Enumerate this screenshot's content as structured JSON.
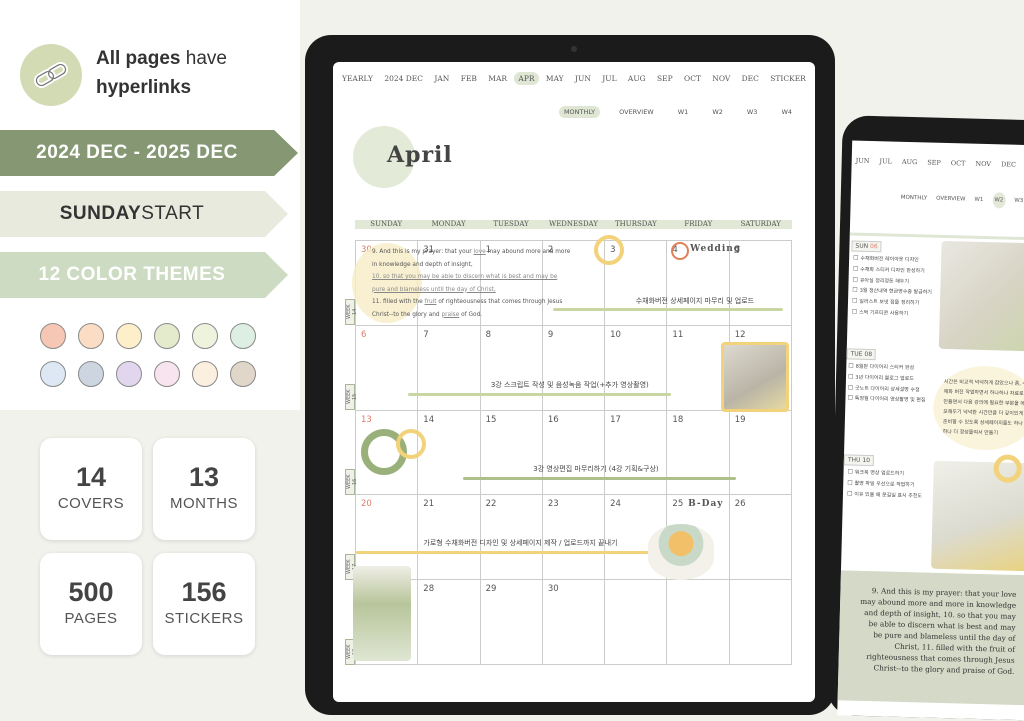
{
  "promo": {
    "headline_bold": "All pages",
    "headline_rest": " have",
    "headline_line2": "hyperlinks",
    "link_icon": "link-icon",
    "ribbon1": "2024 DEC - 2025 DEC",
    "ribbon2_bold": "SUNDAY",
    "ribbon2_rest": " START",
    "ribbon3": "12 COLOR THEMES",
    "swatches": [
      "#f6c7b4",
      "#fbdcc4",
      "#fcefca",
      "#e3ebcc",
      "#eef3de",
      "#dcefe2",
      "#dde8f4",
      "#cdd5e1",
      "#e2d5ee",
      "#f8e4ef",
      "#fbefdf",
      "#e0d7ca"
    ],
    "stats": [
      {
        "num": "14",
        "label": "COVERS"
      },
      {
        "num": "13",
        "label": "MONTHS"
      },
      {
        "num": "500",
        "label": "PAGES"
      },
      {
        "num": "156",
        "label": "STICKERS"
      }
    ]
  },
  "main": {
    "nav": [
      "YEARLY",
      "2024 DEC",
      "JAN",
      "FEB",
      "MAR",
      "APR",
      "MAY",
      "JUN",
      "JUL",
      "AUG",
      "SEP",
      "OCT",
      "NOV",
      "DEC",
      "STICKER"
    ],
    "nav_active": "APR",
    "subnav": [
      "MONTHLY",
      "OVERVIEW",
      "W1",
      "W2",
      "W3",
      "W4"
    ],
    "subnav_active": "MONTHLY",
    "month": "April",
    "weekdays": [
      "SUNDAY",
      "MONDAY",
      "TUESDAY",
      "WEDNESDAY",
      "THURSDAY",
      "FRIDAY",
      "SATURDAY"
    ],
    "dates": [
      "30",
      "31",
      "1",
      "2",
      "3",
      "4",
      "5",
      "6",
      "7",
      "8",
      "9",
      "10",
      "11",
      "12",
      "13",
      "14",
      "15",
      "16",
      "17",
      "18",
      "19",
      "20",
      "21",
      "22",
      "23",
      "24",
      "25",
      "26",
      "",
      "28",
      "29",
      "30",
      "",
      "",
      ""
    ],
    "weeks": [
      "WEEK 14",
      "WEEK 15",
      "WEEK 16",
      "WEEK 17",
      "WEEK 18"
    ],
    "events": {
      "wedding": "Wedding",
      "bday": "B-Day"
    },
    "tasks": [
      "수채화버전 상세페이지 마무리 및 업로드",
      "3강 스크립트 작성 및 음성녹음 작업(+추가 영상촬영)",
      "3강 영상편집 마무리하기 (4강 기획&구상)",
      "가로형 수채화버전 디자인 및 상세페이지 제작 / 업로드까지 끝내기"
    ],
    "verse": [
      "9. And this is my prayer: that your ",
      "love",
      " may abound more and more in knowledge and depth of insight,",
      "10. so that you may be able to discern what is best and may be pure and blameless until the day of Christ,",
      "11. filled with the ",
      "fruit",
      " of righteousness that comes through Jesus Christ--to the glory and ",
      "praise",
      " of God."
    ],
    "colors": {
      "accent": "#dfe6d3",
      "yellow": "#f2d27a",
      "orange": "#e0805a",
      "green": "#9ab07a"
    }
  },
  "second": {
    "nav": [
      "JUN",
      "JUL",
      "AUG",
      "SEP",
      "OCT",
      "NOV",
      "DEC"
    ],
    "subnav": [
      "MONTHLY",
      "OVERVIEW",
      "W1",
      "W2",
      "W3"
    ],
    "subnav_active": "W2",
    "sun": {
      "day": "SUN",
      "date": "06",
      "items": [
        "수채화버전 레이아웃 디자인",
        "수채화 스티커 디자인 완성하기",
        "유아실 정리정돈 해두기",
        "3월 정산내역 현금영수증 발급하기",
        "일러스트 보넷 점들 정리하기",
        "스벅 기프티콘 사용하기"
      ]
    },
    "tue": {
      "day": "TUE",
      "date": "08",
      "items": [
        "8월판 다이어리 스티커 완성",
        "3년 다이어리 블로그 업로드",
        "굿노트 다이어리 상세설명 수정",
        "특정월 다이어리 영상촬영 및 편집"
      ]
    },
    "note": "시간은 비교적 넉넉하게 잡았으나 좀, 수채화 버전 작업하면서 하나하나 자료로 만들면서 다음 강의에 필요한 부분을 메모해두기 넉넉한 시간만큼 더 깊이있게 준비할 수 있도록 상세페이지들도 하나하나 더 정성들여서 만들기",
    "thu": {
      "day": "THU",
      "date": "10",
      "items": [
        "워크북 영상 업로드하기",
        "촬영 파일 우선으로 작업하기",
        "이유 있을 때 운길일 표시 추천도"
      ]
    },
    "verse": "9. And this is my prayer: that your love may abound more and more in knowledge and depth of insight, 10. so that you may be able to discern what is best and may be pure and blameless until the day of Christ, 11. filled with the fruit of righteousness that comes through Jesus Christ--to the glory and praise of God."
  }
}
